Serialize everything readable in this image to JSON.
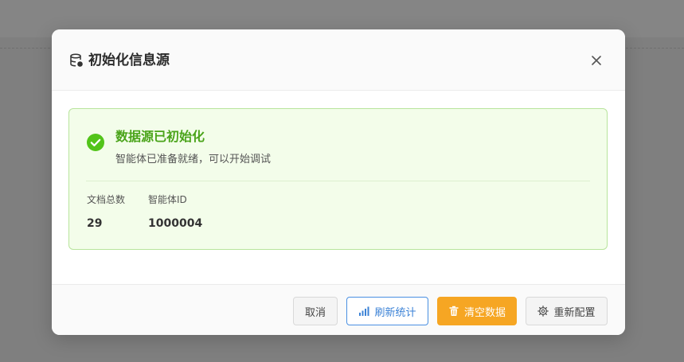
{
  "modal": {
    "title": "初始化信息源",
    "title_icon": "database-icon",
    "close_icon": "close-icon"
  },
  "status": {
    "icon": "check-circle-icon",
    "title": "数据源已初始化",
    "description": "智能体已准备就绪，可以开始调试"
  },
  "stats": [
    {
      "label": "文档总数",
      "value": "29"
    },
    {
      "label": "智能体ID",
      "value": "1000004"
    }
  ],
  "buttons": {
    "cancel": "取消",
    "refresh": "刷新统计",
    "refresh_icon": "bar-chart-icon",
    "clear": "清空数据",
    "clear_icon": "trash-icon",
    "reconfig": "重新配置",
    "reconfig_icon": "gear-icon"
  },
  "colors": {
    "success": "#4aa41a",
    "success_bg": "#f3fdea",
    "primary": "#3b82d6",
    "warning": "#f6a623"
  }
}
